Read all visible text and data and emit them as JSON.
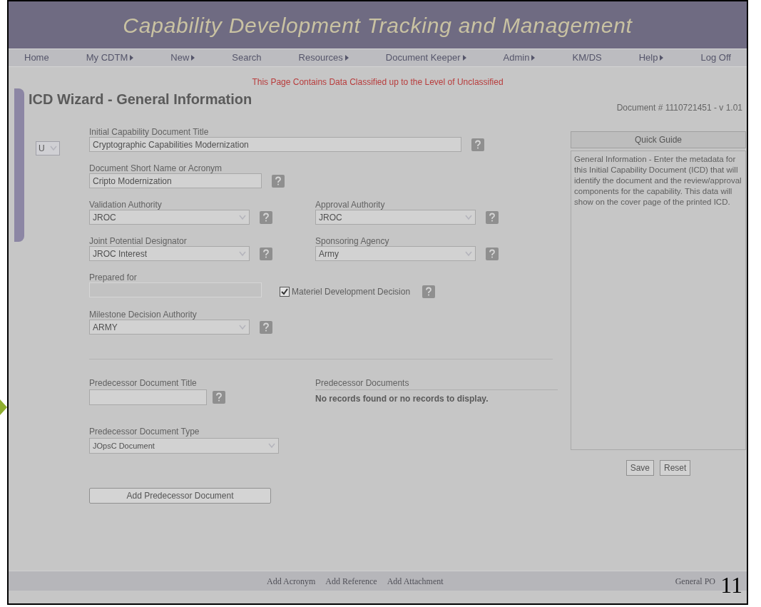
{
  "header": {
    "title": "Capability Development Tracking and Management"
  },
  "nav": [
    {
      "label": "Home",
      "submenu": false
    },
    {
      "label": "My CDTM",
      "submenu": true
    },
    {
      "label": "New",
      "submenu": true
    },
    {
      "label": "Search",
      "submenu": false
    },
    {
      "label": "Resources",
      "submenu": true
    },
    {
      "label": "Document Keeper",
      "submenu": true
    },
    {
      "label": "Admin",
      "submenu": true
    },
    {
      "label": "KM/DS",
      "submenu": false
    },
    {
      "label": "Help",
      "submenu": true
    },
    {
      "label": "Log Off",
      "submenu": false
    }
  ],
  "classification_banner": "This Page Contains Data Classified up to the Level of Unclassified",
  "page_title": "ICD Wizard - General Information",
  "document_number": "Document # 1110721451 - v 1.01",
  "classification_select": {
    "value": "U"
  },
  "form_rows": [
    [
      {
        "kind": "text",
        "label": "Initial Capability Document Title",
        "value": "Cryptographic Capabilities Modernization",
        "wide": true,
        "disabled": false
      }
    ],
    [
      {
        "kind": "text",
        "label": "Document Short Name or Acronym",
        "value": "Cripto Modernization",
        "wide": false,
        "disabled": false
      }
    ],
    [
      {
        "kind": "select",
        "label": "Validation Authority",
        "value": "JROC",
        "wide": false,
        "disabled": false
      },
      {
        "kind": "select",
        "label": "Approval Authority",
        "value": "JROC",
        "wide": false,
        "disabled": false
      }
    ],
    [
      {
        "kind": "select",
        "label": "Joint Potential Designator",
        "value": "JROC Interest",
        "wide": false,
        "disabled": false
      },
      {
        "kind": "select",
        "label": "Sponsoring Agency",
        "value": "Army",
        "wide": false,
        "disabled": false
      }
    ],
    [
      {
        "kind": "text",
        "label": "Prepared for",
        "wide": false,
        "disabled": true
      },
      {
        "kind": "checkbox",
        "label": "Materiel Development Decision",
        "checked": true
      }
    ],
    [
      {
        "kind": "select",
        "label": "Milestone Decision Authority",
        "value": "ARMY",
        "wide": false,
        "disabled": false
      }
    ]
  ],
  "predecessor": {
    "title_label": "Predecessor Document Title",
    "documents_label": "Predecessor Documents",
    "documents_empty": "No records found or no records to display.",
    "type_label": "Predecessor Document Type",
    "type_value": "JOpsC Document",
    "add_button": "Add Predecessor Document"
  },
  "quick_guide": {
    "title": "Quick Guide",
    "text": "General Information - Enter the metadata for this Initial Capability Document (ICD) that will identify the document and the review/approval components for the capability. This data will show on the cover page of the printed ICD."
  },
  "buttons": [
    "Save",
    "Reset"
  ],
  "footer_links": [
    "Add Acronym",
    "Add Reference",
    "Add Attachment"
  ],
  "footer_right": "General PO",
  "slide_number": "11"
}
